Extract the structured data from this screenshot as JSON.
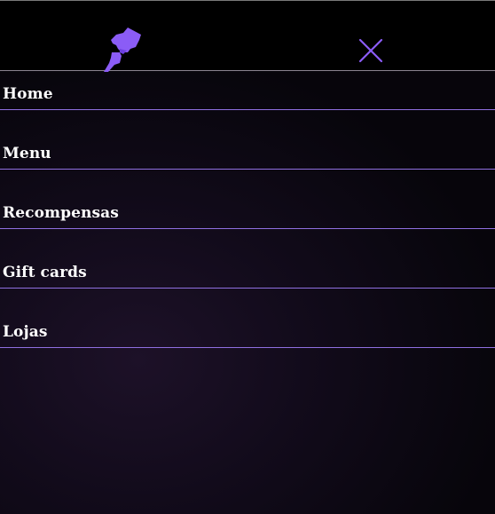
{
  "header": {
    "logo_icon": "pen-nib-logo-icon",
    "close_icon": "close-icon"
  },
  "nav": {
    "items": [
      {
        "label": "Home"
      },
      {
        "label": "Menu"
      },
      {
        "label": "Recompensas"
      },
      {
        "label": "Gift cards"
      },
      {
        "label": "Lojas"
      }
    ]
  },
  "colors": {
    "accent": "#8b5cf6",
    "divider": "#8f6fe0",
    "background_dark": "#07050b",
    "background_glow": "#1d1128",
    "text": "#ffffff"
  }
}
